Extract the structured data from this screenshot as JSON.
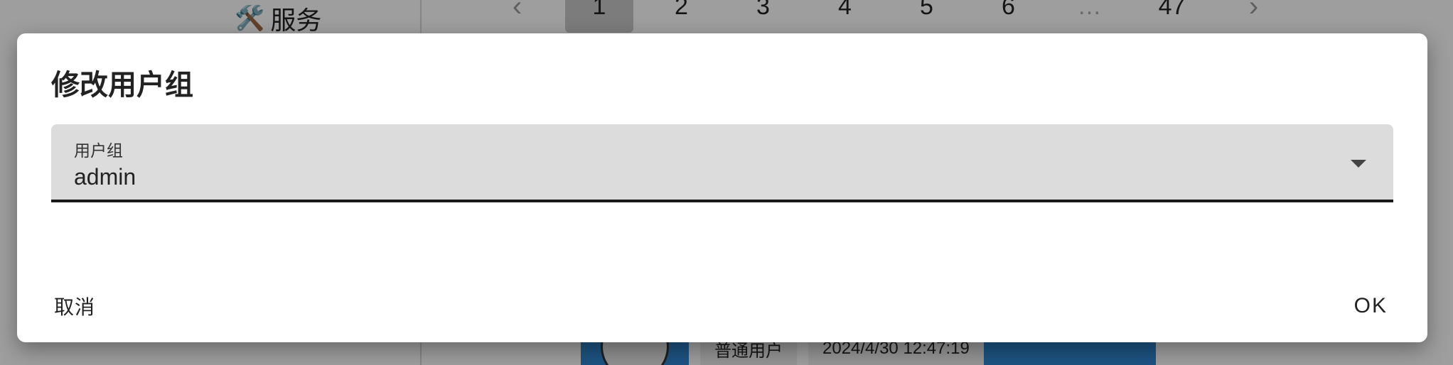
{
  "background": {
    "nav_item": {
      "icon": "🛠️",
      "label": "服务"
    },
    "pagination": {
      "prev": "‹",
      "pages": [
        "1",
        "2",
        "3",
        "4",
        "5",
        "6"
      ],
      "ellipsis": "…",
      "last_page": "47",
      "next": "›",
      "current": "1"
    },
    "row": {
      "role": "普通用户",
      "date": "2024/4/30 12:47:19"
    }
  },
  "dialog": {
    "title": "修改用户组",
    "field": {
      "label": "用户组",
      "value": "admin"
    },
    "cancel_label": "取消",
    "ok_label": "OK"
  },
  "colors": {
    "accent_blue": "#2f86cf",
    "field_bg": "#dcdcdc"
  }
}
